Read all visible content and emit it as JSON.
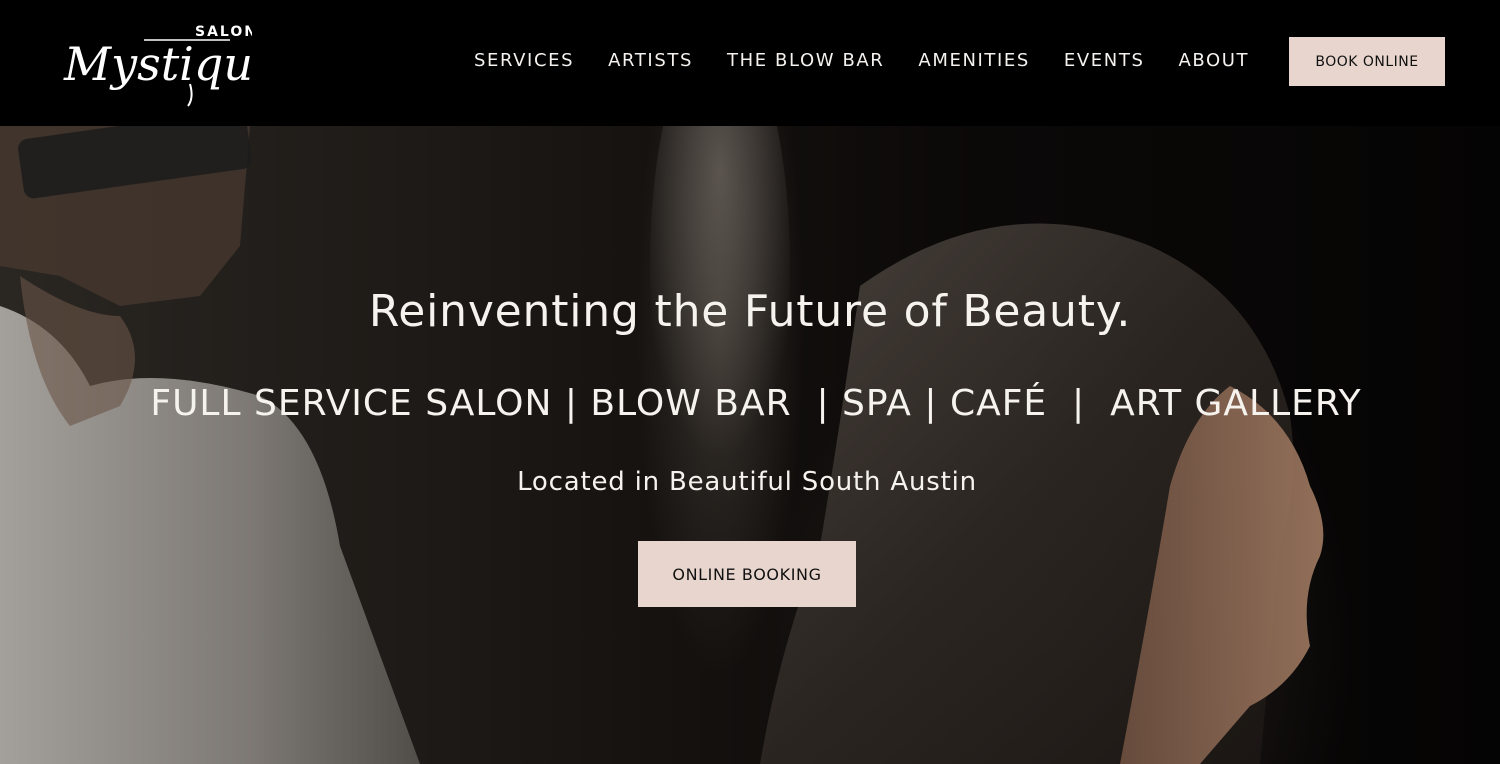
{
  "header": {
    "logo": {
      "small_text": "SALON",
      "script_text": "Mystique"
    },
    "nav": [
      {
        "label": "SERVICES"
      },
      {
        "label": "ARTISTS"
      },
      {
        "label": "THE BLOW BAR"
      },
      {
        "label": "AMENITIES"
      },
      {
        "label": "EVENTS"
      },
      {
        "label": "ABOUT"
      }
    ],
    "book_button": "BOOK ONLINE"
  },
  "hero": {
    "headline": "Reinventing the Future of Beauty.",
    "subline": "FULL SERVICE SALON | BLOW BAR  | SPA | CAFÉ  |  ART GALLERY",
    "location": "Located in Beautiful South Austin",
    "cta_button": "ONLINE BOOKING"
  },
  "colors": {
    "header_bg": "#000000",
    "button_bg": "#e8d6ce",
    "button_text": "#111111",
    "hero_text": "#f6f3ef"
  },
  "icons": {
    "logo": "salon-mystique-logo"
  }
}
